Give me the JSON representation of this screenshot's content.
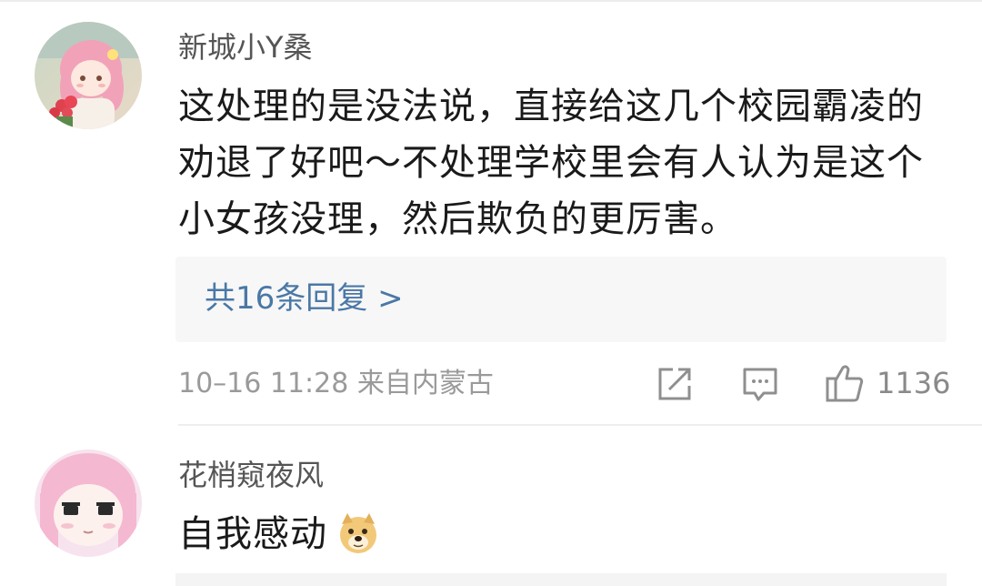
{
  "comments": [
    {
      "username": "新城小Y桑",
      "text_lines": [
        "这处理的是没法说，直接给这几个校园霸凌的",
        "劝退了好吧～不处理学校里会有人认为是这个",
        "小女孩没理，然后欺负的更厉害。"
      ],
      "reply_link": "共16条回复 >",
      "meta": "10–16 11:28  来自内蒙古",
      "actions": {
        "share_icon": "share-icon",
        "comment_icon": "comment-icon",
        "like_icon": "thumbs-up-icon",
        "like_count": "1136"
      }
    },
    {
      "username": "花梢窥夜风",
      "text": "自我感动",
      "emoji": "doge-emoji"
    }
  ],
  "colors": {
    "link": "#4a78a6",
    "meta": "#9a9a9a",
    "reply_bg": "#f7f7f7"
  }
}
